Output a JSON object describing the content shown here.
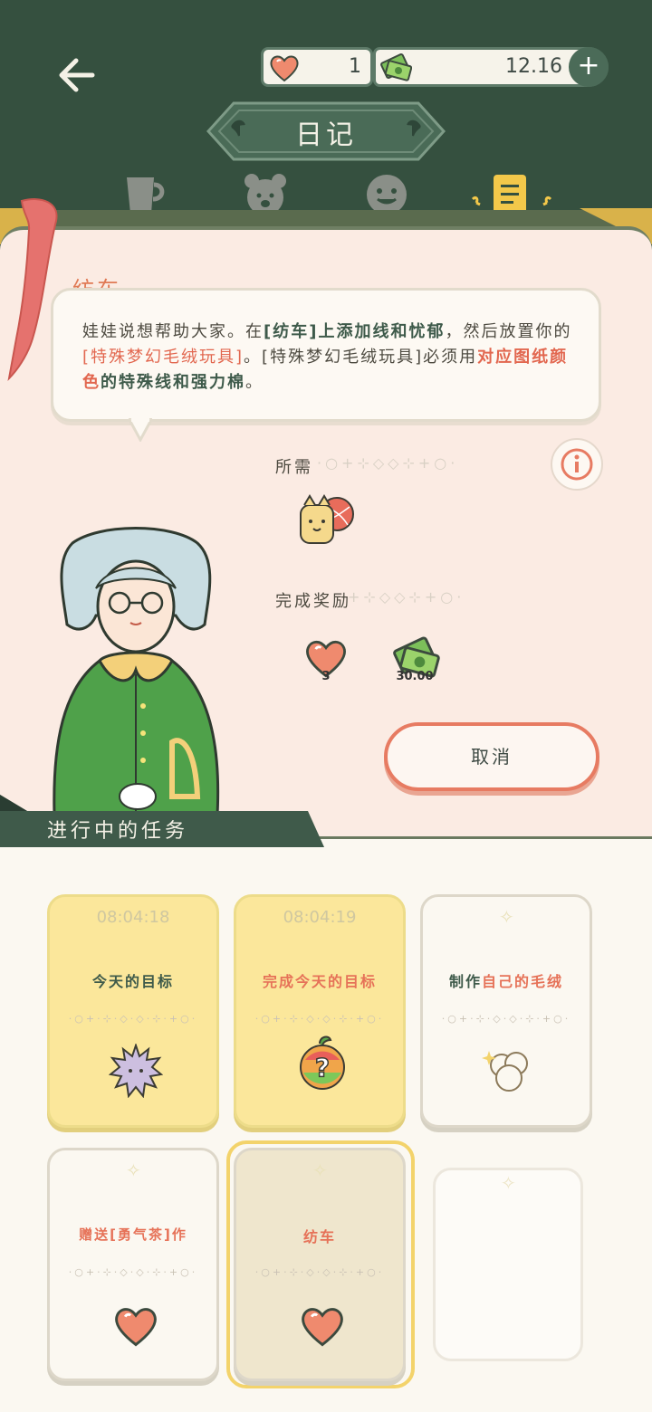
{
  "header": {
    "back_icon": "back-arrow-icon",
    "title": "日记",
    "currency": {
      "hearts": "1",
      "money": "12.16",
      "plus_label": "+"
    },
    "tabs": [
      {
        "name": "cup-icon"
      },
      {
        "name": "bear-icon"
      },
      {
        "name": "face-icon"
      },
      {
        "name": "diary-icon",
        "active": true
      }
    ]
  },
  "quest": {
    "title": "纺车",
    "desc_1": "娃娃说想帮助大家。在",
    "desc_2": "[纺车]上添加线和忧郁",
    "desc_3": "，然后放置你的",
    "desc_4": "[特殊梦幻毛绒玩具]",
    "desc_5": "。[特殊梦幻毛绒玩具]必须用",
    "desc_6": "对应图纸颜色",
    "desc_7": "的特殊线和强力棉",
    "desc_8": "。",
    "required_label": "所需",
    "reward_label": "完成奖励",
    "rewards": [
      {
        "icon": "heart-icon",
        "amount": "3"
      },
      {
        "icon": "money-icon",
        "amount": "30.00"
      }
    ],
    "cancel_label": "取消"
  },
  "tasks": {
    "banner": "进行中的任务",
    "cards": [
      {
        "timer": "08:04:18",
        "title": "今天的目标",
        "style": "yellow",
        "icon": "puffball-icon"
      },
      {
        "timer": "08:04:19",
        "title": "完成今天的目标",
        "style": "yellow",
        "icon": "mystery-fruit-icon"
      },
      {
        "title_a": "制作",
        "title_b": "自己的毛绒",
        "style": "white",
        "icon": "cotton-icon"
      },
      {
        "title": "赠送[勇气茶]作",
        "style": "white",
        "icon": "heart-icon"
      },
      {
        "title": "纺车",
        "style": "selected",
        "icon": "heart-icon"
      },
      {
        "style": "empty"
      }
    ],
    "dots": "·○+·⊹·◇·◇·⊹·+○·"
  },
  "colors": {
    "header_bg": "#35503f",
    "paper_bg": "#fbebe3",
    "accent_red": "#e77b62",
    "card_yellow": "#fbe79b",
    "selected_border": "#f3d36b"
  }
}
